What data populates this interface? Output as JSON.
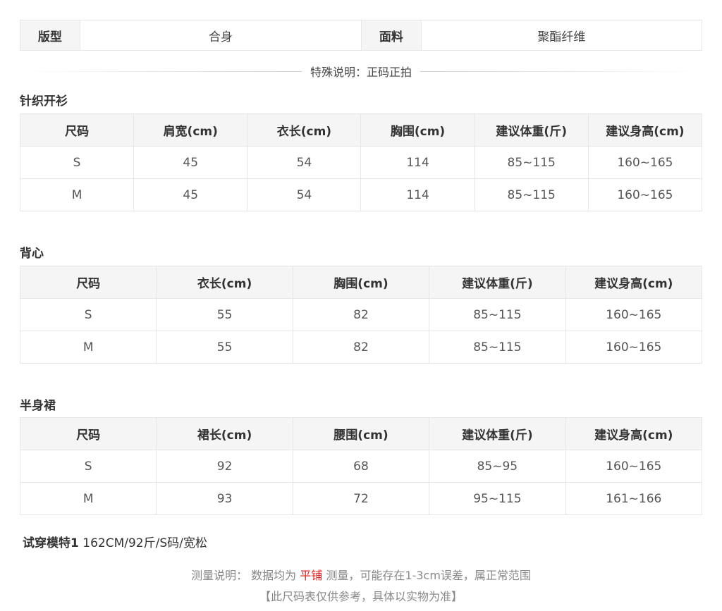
{
  "info": {
    "fit_label": "版型",
    "fit_value": "合身",
    "fabric_label": "面料",
    "fabric_value": "聚酯纤维"
  },
  "special_note": "特殊说明：正码正拍",
  "sections": [
    {
      "title": "针织开衫",
      "headers": [
        "尺码",
        "肩宽(cm)",
        "衣长(cm)",
        "胸围(cm)",
        "建议体重(斤)",
        "建议身高(cm)"
      ],
      "rows": [
        [
          "S",
          "45",
          "54",
          "114",
          "85~115",
          "160~165"
        ],
        [
          "M",
          "45",
          "54",
          "114",
          "85~115",
          "160~165"
        ]
      ]
    },
    {
      "title": "背心",
      "headers": [
        "尺码",
        "衣长(cm)",
        "胸围(cm)",
        "建议体重(斤)",
        "建议身高(cm)"
      ],
      "rows": [
        [
          "S",
          "55",
          "82",
          "85~115",
          "160~165"
        ],
        [
          "M",
          "55",
          "82",
          "85~115",
          "160~165"
        ]
      ]
    },
    {
      "title": "半身裙",
      "headers": [
        "尺码",
        "裙长(cm)",
        "腰围(cm)",
        "建议体重(斤)",
        "建议身高(cm)"
      ],
      "rows": [
        [
          "S",
          "92",
          "68",
          "85~95",
          "160~165"
        ],
        [
          "M",
          "93",
          "72",
          "95~115",
          "161~166"
        ]
      ]
    }
  ],
  "model": {
    "label": "试穿模特1",
    "value": " 162CM/92斤/S码/宽松"
  },
  "footer": {
    "measure_prefix": "测量说明：  数据均为 ",
    "measure_highlight": "平铺",
    "measure_suffix": " 测量，可能存在1-3cm误差，属正常范围",
    "disclaimer": "【此尺码表仅供参考，具体以实物为准】"
  },
  "colors": {
    "highlight": "#e02020",
    "header_bg": "#f5f5f5",
    "border": "#e6e6e6"
  }
}
